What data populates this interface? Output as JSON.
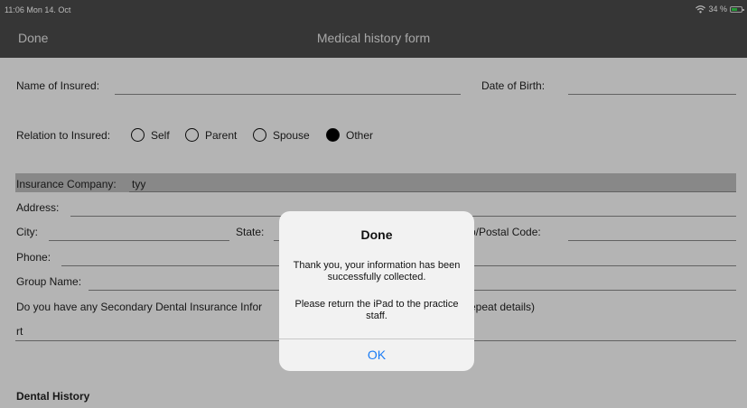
{
  "status": {
    "time": "11:06",
    "date": "Mon 14. Oct",
    "wifi_icon": "wifi-icon",
    "battery": "34 %"
  },
  "nav": {
    "done_label": "Done",
    "title": "Medical history form"
  },
  "form": {
    "name_label": "Name of Insured:",
    "dob_label": "Date of Birth:",
    "relation_label": "Relation to Insured:",
    "relation_options": [
      "Self",
      "Parent",
      "Spouse",
      "Other"
    ],
    "relation_selected": "Other",
    "insurance_company_label": "Insurance Company:",
    "insurance_company_value": "tyy",
    "address_label": "Address:",
    "city_label": "City:",
    "state_label": "State:",
    "postal_label": "p/Postal Code:",
    "phone_label": "Phone:",
    "group_label": "Group Name:",
    "secondary_question_left": "Do you have any Secondary Dental Insurance Infor",
    "secondary_question_right": "epeat details)",
    "secondary_value": "rt",
    "dental_history_heading": "Dental History"
  },
  "alert": {
    "title": "Done",
    "message1": "Thank you, your information has been successfully collected.",
    "message2": "Please return the iPad to the practice staff.",
    "ok_label": "OK"
  },
  "colors": {
    "nav_bg": "#4c4c4c",
    "link_blue": "#1a7cf5",
    "battery_green": "#32d74b"
  }
}
